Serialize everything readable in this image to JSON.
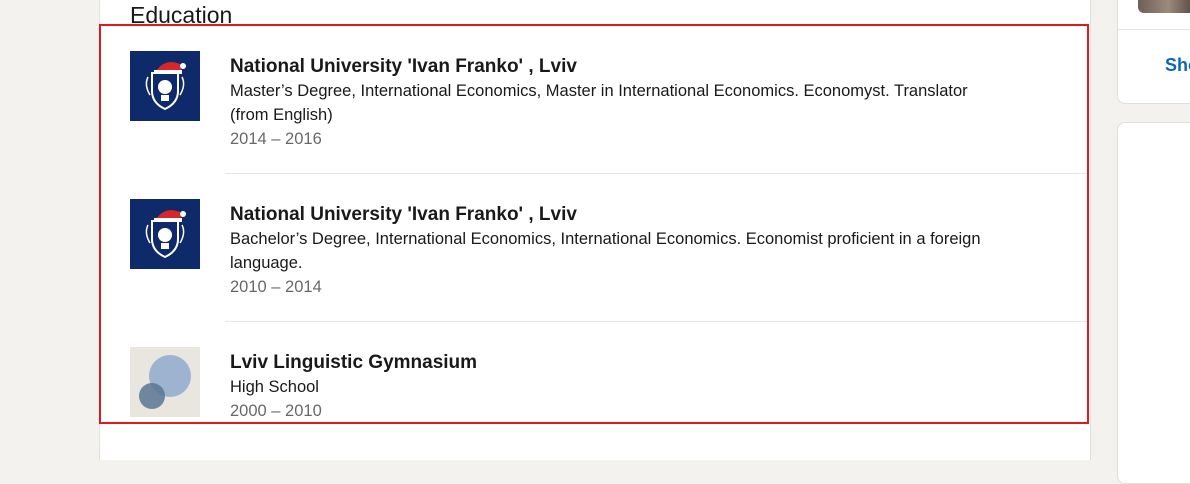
{
  "section": {
    "title": "Education"
  },
  "education": [
    {
      "school": "National University 'Ivan Franko' , Lviv",
      "degree": "Master’s Degree, International Economics, Master in International Economics. Economyst. Translator (from English)",
      "dates": "2014 – 2016",
      "logo_icon": "university-crest-icon"
    },
    {
      "school": "National University 'Ivan Franko' , Lviv",
      "degree": "Bachelor’s Degree, International Economics, International Economics. Economist proficient in a foreign language.",
      "dates": "2010 – 2014",
      "logo_icon": "university-crest-icon"
    },
    {
      "school": "Lviv Linguistic Gymnasium",
      "degree": "High School",
      "dates": "2000 – 2010",
      "logo_icon": "default-school-icon"
    }
  ],
  "sidebar": {
    "show_link": "Sho"
  },
  "colors": {
    "highlight_border": "#e01b1b",
    "link": "#0a66c2",
    "crest_background": "#0e2a6b",
    "page_background": "#f3f2ef"
  }
}
